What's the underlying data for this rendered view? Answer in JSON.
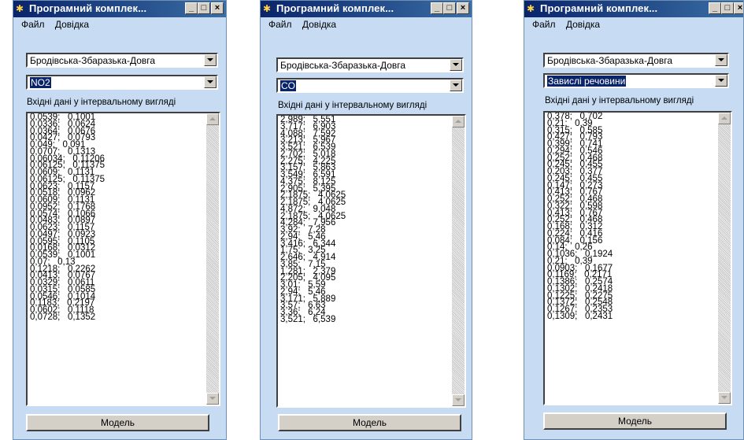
{
  "windows": [
    {
      "title": "Програмний комплек...",
      "controls": {
        "minimize": "_",
        "maximize": "□",
        "close": "×"
      },
      "menu": [
        "Файл",
        "Довідка"
      ],
      "region_select": "Бродівська-Збаразька-Довга",
      "pollutant_select": "NO2",
      "input_label": "Вхідні дані у інтервальному вигляді",
      "intervals": [
        "0,0539;   0,1001",
        "0,0336;   0,0624",
        "0,0364;   0,0676",
        "0,0427;   0,0793",
        "0,049;   0,091",
        "0,0707;   0,1313",
        "0,06034;   0,11206",
        "0,06125;   0,11375",
        "0,0609;   0,1131",
        "0,06125;   0,11375",
        "0,0623;   0,1157",
        "0,0518;   0,0962",
        "0,0609;   0,1131",
        "0,0952;   0,1768",
        "0,0574;   0,1066",
        "0,0483;   0,0897",
        "0,0623;   0,1157",
        "0,0497;   0,0923",
        "0,0595;   0,1105",
        "0,0168;   0,0312",
        "0,0539;   0,1001",
        "0,07;   0,13",
        "0,1218;   0,2262",
        "0,0413;   0,0767",
        "0,0329;   0,0611",
        "0,0315;   0,0585",
        "0,0546;   0,1014",
        "0,1183;   0,2197",
        "0,0602;   0,1118",
        "0,0728;   0,1352"
      ],
      "model_button": "Модель"
    },
    {
      "title": "Програмний комплек...",
      "controls": {
        "minimize": "_",
        "maximize": "□",
        "close": "×"
      },
      "menu": [
        "Файл",
        "Довідка"
      ],
      "region_select": "Бродівська-Збаразька-Довга",
      "pollutant_select": "CO",
      "input_label": "Вхідні дані у інтервальному вигляді",
      "intervals": [
        "2,989;   5,551",
        "3,717;   6,903",
        "4,088;   7,592",
        "3,213;   5,967",
        "3,521;   6,539",
        "2,702;   5,018",
        "2,275;   4,225",
        "3,157;   5,863",
        "3,549;   6,591",
        "4,375;   8,125",
        "2,905;   5,395",
        "2,1875;   4,0625",
        "2,1875;   4,0625",
        "4,872;   9,048",
        "2,1875;   4,0625",
        "4,284;   7,956",
        "3,92;   7,28",
        "2,94;   5,46",
        "3,416;   6,344",
        "1,75;   3,25",
        "2,646;   4,914",
        "3,85;   7,15",
        "1,281;   2,379",
        "2,205;   4,095",
        "3,01;   5,59",
        "2,94;   5,46",
        "3,171;   5,889",
        "3,57;   6,63",
        "3,36;   6,24",
        "3,521;   6,539"
      ],
      "model_button": "Модель"
    },
    {
      "title": "Програмний комплек...",
      "controls": {
        "minimize": "_",
        "maximize": "□",
        "close": "×"
      },
      "menu": [
        "Файл",
        "Довідка"
      ],
      "region_select": "Бродівська-Збаразька-Довга",
      "pollutant_select": "Завислі речовини",
      "input_label": "Вхідні дані у інтервальному вигляді",
      "intervals": [
        "0,378;   0,702",
        "0,21;   0,39",
        "0,315;   0,585",
        "0,427;   0,793",
        "0,399;   0,741",
        "0,294;   0,546",
        "0,252;   0,468",
        "0,245;   0,455",
        "0,203;   0,377",
        "0,245;   0,455",
        "0,147;   0,273",
        "0,413;   0,767",
        "0,252;   0,468",
        "0,322;   0,598",
        "0,413;   0,767",
        "0,252;   0,468",
        "0,168;   0,312",
        "0,224;   0,416",
        "0,084;   0,156",
        "0,14;   0,26",
        "0,1036;   0,1924",
        "0,21;   0,39",
        "0,0903;   0,1677",
        "0,1169;   0,2171",
        "0,1386;   0,2574",
        "0,1302;   0,2418",
        "0,1225;   0,2275",
        "0,1372;   0,2548",
        "0,1267;   0,2353",
        "0,1309;   0,2431"
      ],
      "model_button": "Модель"
    }
  ]
}
